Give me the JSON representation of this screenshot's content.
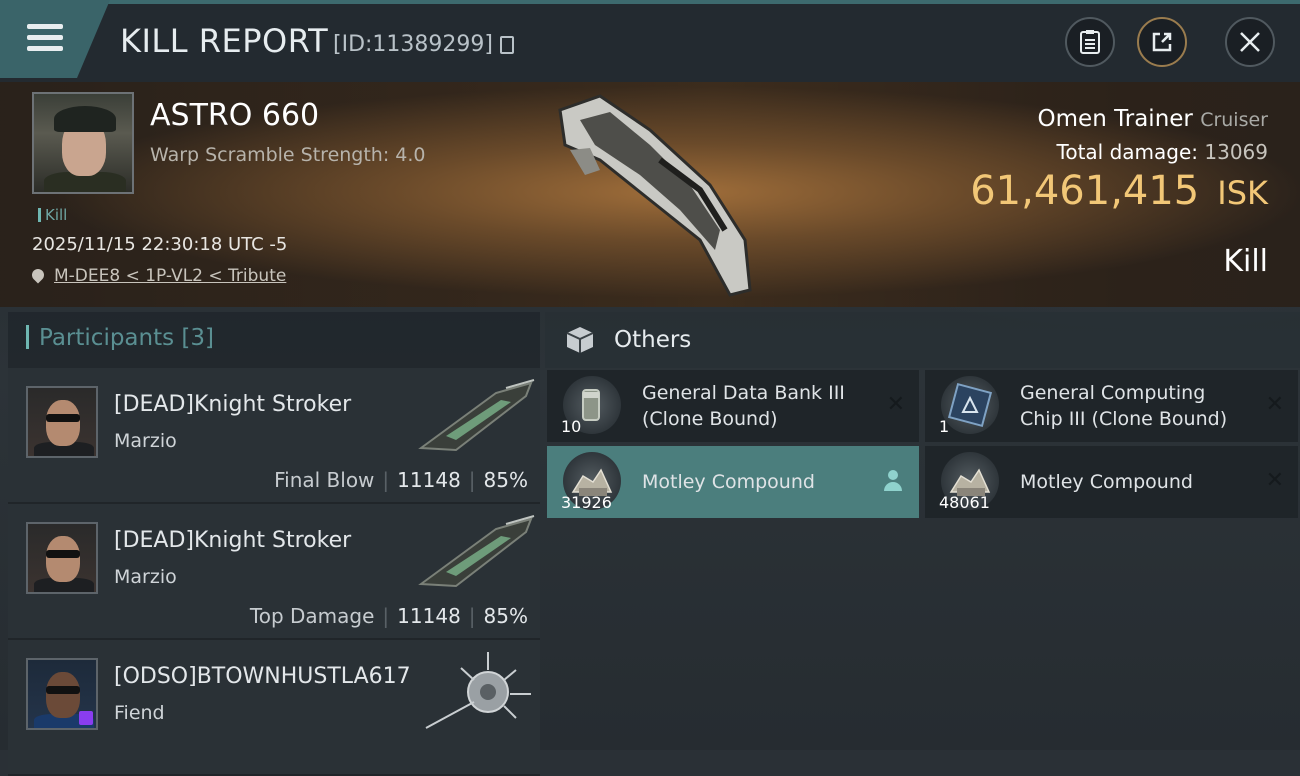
{
  "header": {
    "title": "KILL REPORT",
    "report_id": "[ID:11389299]"
  },
  "victim": {
    "name": "ASTRO 660",
    "warp_scramble": "Warp Scramble Strength: 4.0",
    "tag": "Kill",
    "timestamp": "2025/11/15 22:30:18 UTC -5",
    "location": "M-DEE8 < 1P-VL2 < Tribute"
  },
  "ship": {
    "name": "Omen Trainer",
    "class": "Cruiser",
    "total_damage_label": "Total damage:",
    "total_damage_value": "13069",
    "isk_value": "61,461,415",
    "isk_unit": "ISK",
    "result": "Kill"
  },
  "participants": {
    "title": "Participants",
    "count": "[3]",
    "rows": [
      {
        "name": "[DEAD]Knight Stroker",
        "ship": "Marzio",
        "label": "Final Blow",
        "damage": "11148",
        "percent": "85%"
      },
      {
        "name": "[DEAD]Knight Stroker",
        "ship": "Marzio",
        "label": "Top Damage",
        "damage": "11148",
        "percent": "85%"
      },
      {
        "name": "[ODSO]BTOWNHUSTLA617",
        "ship": "Fiend"
      }
    ]
  },
  "others": {
    "title": "Others",
    "items": [
      {
        "qty": "10",
        "name_line1": "General Data Bank III",
        "name_line2": "(Clone Bound)"
      },
      {
        "qty": "1",
        "name_line1": "General Computing",
        "name_line2": "Chip III (Clone Bound)"
      },
      {
        "qty": "31926",
        "name": "Motley Compound"
      },
      {
        "qty": "48061",
        "name": "Motley Compound"
      }
    ]
  },
  "icons": [
    "menu-icon",
    "copy-icon",
    "clipboard-icon",
    "share-icon",
    "close-icon",
    "location-pin-icon",
    "box-icon",
    "remove-icon",
    "person-icon"
  ],
  "colors": {
    "accent": "#4b7e7d",
    "isk": "#f2c777",
    "participants_title": "#5a8f92"
  }
}
